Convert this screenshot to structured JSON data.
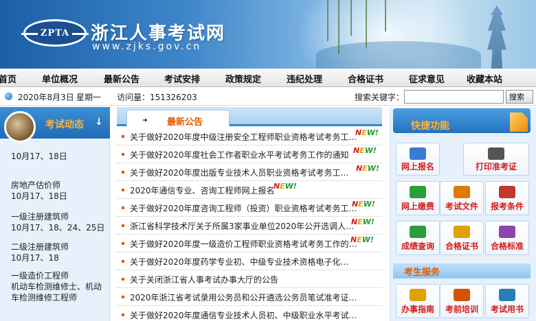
{
  "header": {
    "logo_text": "ZPTA",
    "site_title": "浙江人事考试网",
    "site_url": "www.zjks.gov.cn"
  },
  "nav": {
    "items": [
      "首页",
      "单位概况",
      "最新公告",
      "考试安排",
      "政策规定",
      "违纪处理",
      "合格证书",
      "征求意见",
      "收藏本站"
    ]
  },
  "infobar": {
    "date": "2020年8月3日",
    "weekday": "星期一",
    "visits": "访问量：151326203",
    "search_label": "搜索关键字：",
    "search_value": "",
    "search_button": "搜索"
  },
  "left": {
    "title": "考试动态",
    "arrow": "↓",
    "items": [
      "房地产估价师",
      "10月17、18日",
      "房地产估价师",
      "10月17、18日",
      "一级注册建筑师",
      "10月17、18、24、25日",
      "二级注册建筑师",
      "10月17、18",
      "一级造价工程师",
      "机动车检测维修士、机动车检测维修工程师"
    ]
  },
  "middle": {
    "tab_label": "最新公告",
    "tab_icon": "➜",
    "new_badge": [
      "N",
      "E",
      "W",
      "!"
    ],
    "notices": [
      {
        "text": "关于做好2020年度中级注册安全工程师职业资格考试考务工…",
        "new": true
      },
      {
        "text": "关于做好2020年度社会工作者职业水平考试考务工作的通知",
        "new": true
      },
      {
        "text": "关于做好2020年度出版专业技术人员职业资格考试考务工…",
        "new": true
      },
      {
        "text": "2020年通信专业、咨询工程师网上报名",
        "new": true
      },
      {
        "text": "关于做好2020年度咨询工程师（投资）职业资格考试考务工…",
        "new": true
      },
      {
        "text": "浙江省科学技术厅关于所属3家事业单位2020年公开选调人…",
        "new": true
      },
      {
        "text": "关于做好2020年度一级造价工程师职业资格考试考务工作的…",
        "new": true
      },
      {
        "text": "关于做好2020年度药学专业初、中级专业技术资格电子化…",
        "new": false
      },
      {
        "text": "关于关闭浙江省人事考试办事大厅的公告",
        "new": false
      },
      {
        "text": "2020年浙江省考试录用公务员和公开遴选公务员笔试准考证…",
        "new": false
      },
      {
        "text": "关于做好2020年度通信专业技术人员初、中级职业水平考试…",
        "new": false
      }
    ]
  },
  "right": {
    "title": "快捷功能",
    "buttons": [
      {
        "label": "网上报名",
        "icon": "laptop-icon"
      },
      {
        "label": "打印准考证",
        "icon": "printer-icon"
      },
      {
        "label": "网上缴费",
        "icon": "payment-icon"
      },
      {
        "label": "考试文件",
        "icon": "folder-icon"
      },
      {
        "label": "报考条件",
        "icon": "user-icon"
      },
      {
        "label": "成绩查询",
        "icon": "search-book-icon"
      },
      {
        "label": "合格证书",
        "icon": "certificate-icon"
      },
      {
        "label": "合格标准",
        "icon": "standard-icon"
      }
    ],
    "service_title": "考生服务",
    "service_buttons": [
      {
        "label": "办事指南",
        "icon": "guide-icon"
      },
      {
        "label": "考前培训",
        "icon": "training-icon"
      },
      {
        "label": "考试用书",
        "icon": "book-icon"
      }
    ]
  }
}
